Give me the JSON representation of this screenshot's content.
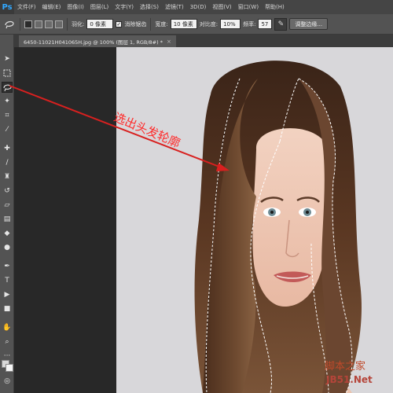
{
  "app": {
    "logo": "Ps"
  },
  "menu": [
    "文件(F)",
    "编辑(E)",
    "图像(I)",
    "图层(L)",
    "文字(Y)",
    "选择(S)",
    "滤镜(T)",
    "3D(D)",
    "视图(V)",
    "窗口(W)",
    "帮助(H)"
  ],
  "options": {
    "feather_label": "羽化:",
    "feather_value": "0 像素",
    "antialias_label": "消除锯齿",
    "width_label": "宽度:",
    "width_value": "10 像素",
    "contrast_label": "对比度:",
    "contrast_value": "10%",
    "frequency_label": "频率:",
    "frequency_value": "57",
    "refine_edge_label": "调整边缘..."
  },
  "document_tab": {
    "title": "6450-11021H041065H.jpg @ 100% (图层 1, RGB/8#) *",
    "close": "×"
  },
  "annotation": {
    "text": "选出头发轮廓",
    "color": "#ff2a2a"
  },
  "watermark": {
    "line1": "脚本之家",
    "line2": "JB51.Net"
  },
  "colors": {
    "accent": "#ff2a2a",
    "background": "#282828",
    "panel": "#535353"
  },
  "toolbox_icons": [
    "move-icon",
    "marquee-icon",
    "magnetic-lasso-icon",
    "magic-wand-icon",
    "crop-icon",
    "eyedropper-icon",
    "healing-brush-icon",
    "brush-icon",
    "clone-stamp-icon",
    "history-brush-icon",
    "eraser-icon",
    "gradient-icon",
    "blur-icon",
    "dodge-icon",
    "pen-icon",
    "type-icon",
    "path-selection-icon",
    "shape-icon",
    "hand-icon",
    "zoom-icon"
  ]
}
